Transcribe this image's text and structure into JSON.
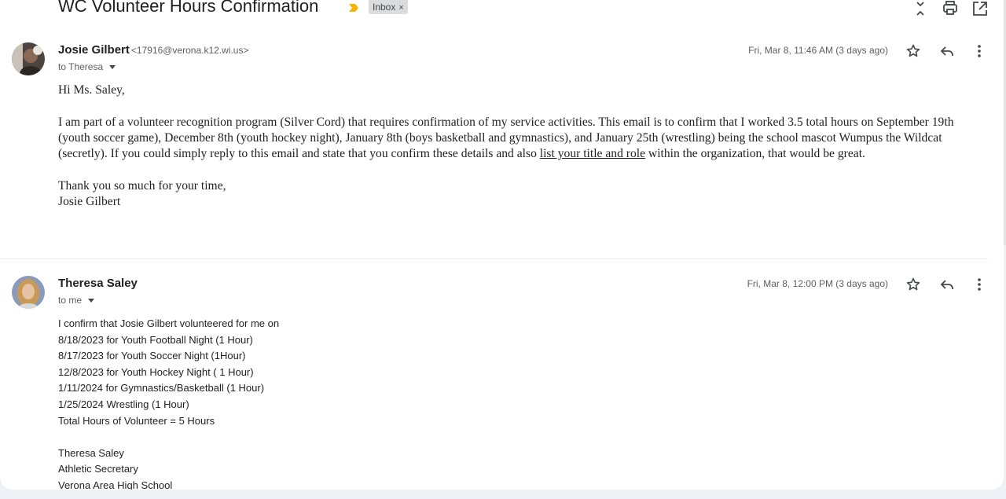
{
  "thread": {
    "subject": "WC Volunteer Hours Confirmation",
    "label": "Inbox",
    "label_remove": "×"
  },
  "icons": {
    "importance": "importance-marker-icon",
    "collapse": "collapse-all-icon",
    "print": "print-icon",
    "open_new_window": "open-in-new-window-icon",
    "star": "star-icon",
    "reply": "reply-icon",
    "more": "more-vert-icon"
  },
  "colors": {
    "importance": "#f4b400",
    "label_chip_bg": "#dadce0",
    "page_bg": "#eef1f6"
  },
  "messages": [
    {
      "sender_name": "Josie Gilbert",
      "sender_email": "<17916@verona.k12.wi.us>",
      "to": "to Theresa",
      "date": "Fri, Mar 8, 11:46 AM (3 days ago)",
      "greeting": "Hi Ms. Saley,",
      "para_before_link": "I am part of a volunteer recognition program (Silver Cord) that requires confirmation of my service activities. This email is to confirm that I worked 3.5 total hours on September 19th (youth soccer game), December 8th (youth hockey night), January 8th (boys basketball and gymnastics), and January 25th (wrestling) being the school mascot Wumpus the Wildcat (secretly). If you could simply reply to this email and state that you confirm these details and also ",
      "link_text": "list your title and role",
      "para_after_link": " within the organization, that would be great.",
      "closing": "Thank you so much for your time,",
      "signature": "Josie Gilbert"
    },
    {
      "sender_name": "Theresa Saley",
      "to": "to me",
      "date": "Fri, Mar 8, 12:00 PM (3 days ago)",
      "lines": [
        "I confirm that Josie Gilbert volunteered for me on",
        "8/18/2023 for Youth Football Night (1 Hour)",
        "8/17/2023 for Youth Soccer Night (1Hour)",
        "12/8/2023 for Youth Hockey Night ( 1 Hour)",
        "1/11/2024 for Gymnastics/Basketball (1 Hour)",
        "1/25/2024 Wrestling (1 Hour)",
        "Total Hours of Volunteer = 5 Hours"
      ],
      "signature_lines": [
        "Theresa Saley",
        "Athletic Secretary",
        "Verona Area High School"
      ]
    }
  ]
}
